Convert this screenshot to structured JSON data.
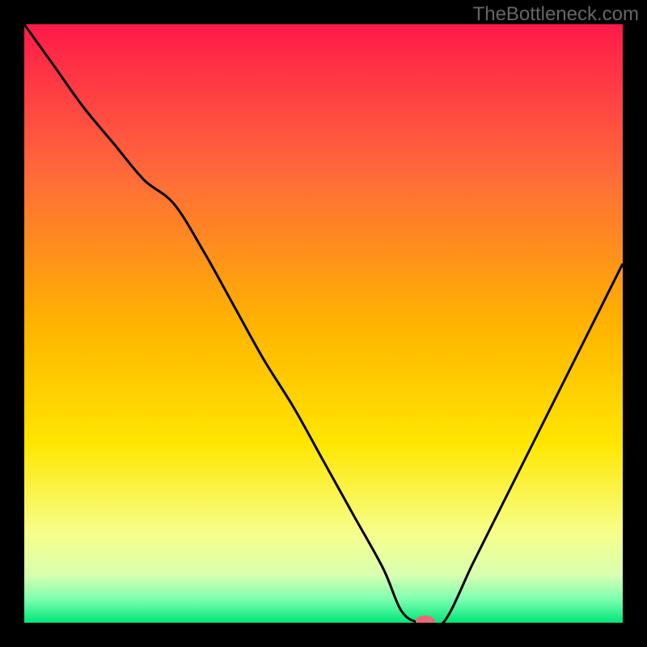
{
  "watermark": "TheBottleneck.com",
  "chart_data": {
    "type": "line",
    "title": "",
    "xlabel": "",
    "ylabel": "",
    "xlim": [
      0,
      100
    ],
    "ylim": [
      0,
      100
    ],
    "x": [
      0,
      5,
      10,
      15,
      20,
      25,
      30,
      35,
      40,
      45,
      50,
      55,
      60,
      63,
      66,
      70,
      75,
      80,
      85,
      90,
      95,
      100
    ],
    "values": [
      100,
      93,
      86,
      80,
      74,
      70,
      62,
      53,
      44,
      36,
      27,
      18,
      9,
      2,
      0,
      0,
      10,
      20,
      30,
      40,
      50,
      60
    ],
    "marker": {
      "x": 67,
      "y": 0,
      "color": "#e86a78",
      "rx": 12,
      "ry": 7
    },
    "gradient_stops": [
      {
        "offset": 0.0,
        "color": "#ff1a4a"
      },
      {
        "offset": 0.25,
        "color": "#ff6a3a"
      },
      {
        "offset": 0.5,
        "color": "#ffb300"
      },
      {
        "offset": 0.7,
        "color": "#ffe600"
      },
      {
        "offset": 0.85,
        "color": "#f7ff8a"
      },
      {
        "offset": 0.92,
        "color": "#d9ffb0"
      },
      {
        "offset": 0.96,
        "color": "#7fffb0"
      },
      {
        "offset": 1.0,
        "color": "#00e67a"
      }
    ]
  }
}
